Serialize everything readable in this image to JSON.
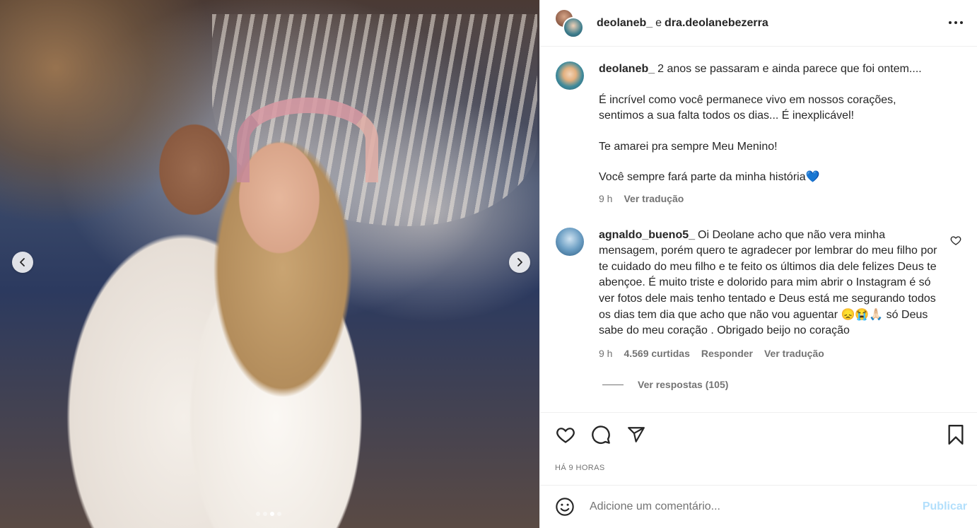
{
  "header": {
    "username_1": "deolaneb_",
    "conjunction": "e",
    "username_2": "dra.deolanebezerra"
  },
  "caption": {
    "username": "deolaneb_",
    "line_1": "2 anos se passaram e ainda parece que foi ontem....",
    "para_2": "É incrível como você permanece vivo em nossos corações, sentimos a sua falta todos os dias... É inexplicável!",
    "para_3": "Te amarei pra sempre Meu Menino!",
    "para_4": "Você sempre fará parte da minha história💙",
    "time": "9 h",
    "translate": "Ver tradução"
  },
  "comment": {
    "username": "agnaldo_bueno5_",
    "text": "Oi Deolane acho que não vera minha mensagem, porém quero te agradecer por lembrar do meu filho por te cuidado do meu filho e te feito os últimos dia dele felizes Deus te abençoe. É muito triste e dolorido para mim abrir o Instagram é só ver fotos dele mais tenho tentado e Deus está me segurando todos os dias tem dia que acho que não vou aguentar 😞😭🙏🏻  só Deus sabe do meu coração . Obrigado beijo no coração",
    "time": "9 h",
    "likes": "4.569 curtidas",
    "reply": "Responder",
    "translate": "Ver tradução",
    "view_replies": "Ver respostas (105)"
  },
  "post": {
    "timestamp": "HÁ 9 HORAS"
  },
  "add_comment": {
    "placeholder": "Adicione um comentário...",
    "publish": "Publicar"
  },
  "carousel": {
    "total": 4,
    "active_index": 2
  },
  "colors": {
    "text": "#262626",
    "secondary": "#737373",
    "publish_disabled": "#b2dffc",
    "border": "#efefef"
  }
}
